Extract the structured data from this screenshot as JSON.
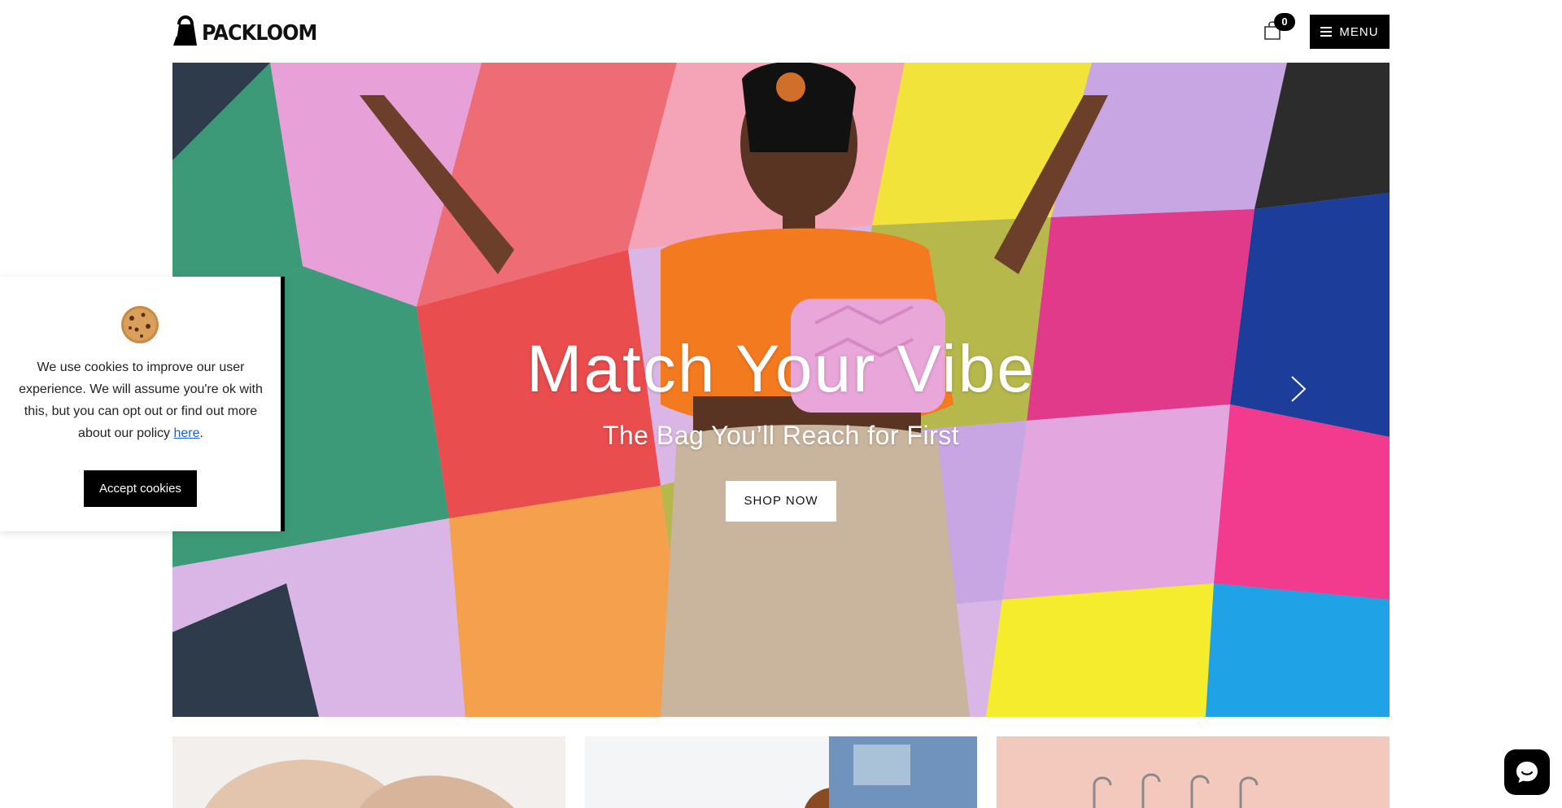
{
  "header": {
    "logo_text": "PACKLOOM",
    "cart_count": "0",
    "menu_label": "MENU"
  },
  "hero": {
    "title": "Match Your Vibe",
    "subtitle": "The Bag You’ll Reach for First",
    "cta_label": "SHOP NOW"
  },
  "cookie": {
    "text_before_link": "We use cookies to improve our user experience. We will assume you're ok with this, but you can opt out or find out more about our policy ",
    "link_text": "here",
    "text_after_link": ".",
    "accept_label": "Accept cookies"
  },
  "colors": {
    "accent": "#000000",
    "link": "#1a5fd6",
    "shirt": "#f47a1f",
    "bag": "#e9a6d9"
  },
  "icons": [
    "bag-logo-icon",
    "shopping-bag-icon",
    "hamburger-icon",
    "chevron-right-icon",
    "cookie-icon",
    "chat-icon"
  ]
}
